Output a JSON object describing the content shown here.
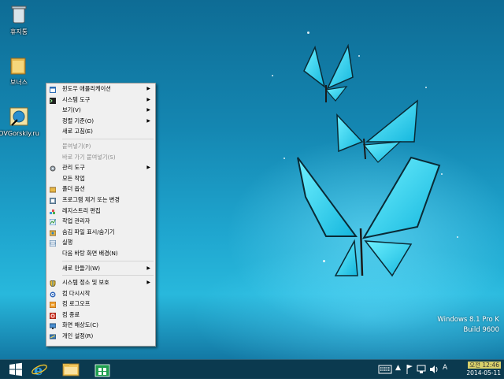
{
  "desktop": {
    "icons": [
      {
        "label": "휴지통",
        "icon": "recycle-bin-icon"
      },
      {
        "label": "보너스",
        "icon": "folder-icon"
      },
      {
        "label": "OVGorskiy.ru",
        "icon": "website-shortcut-icon"
      }
    ],
    "watermark": {
      "line1": "Windows 8.1 Pro K",
      "line2": "Build 9600"
    }
  },
  "context_menu": {
    "items": [
      {
        "label": "윈도우 애플리케이션",
        "icon": "app-window-icon",
        "submenu": true,
        "disabled": false
      },
      {
        "label": "시스템 도구",
        "icon": "terminal-icon",
        "submenu": true,
        "disabled": false
      },
      {
        "label": "보기(V)",
        "icon": "",
        "submenu": true,
        "disabled": false
      },
      {
        "label": "정렬 기준(O)",
        "icon": "",
        "submenu": true,
        "disabled": false
      },
      {
        "label": "새로 고침(E)",
        "icon": "",
        "submenu": false,
        "disabled": false
      },
      {
        "sep": true
      },
      {
        "label": "붙여넣기(P)",
        "icon": "",
        "submenu": false,
        "disabled": true
      },
      {
        "label": "바로 가기 붙여넣기(S)",
        "icon": "",
        "submenu": false,
        "disabled": true
      },
      {
        "label": "관리 도구",
        "icon": "admin-tools-icon",
        "submenu": true,
        "disabled": false
      },
      {
        "label": "모든 작업",
        "icon": "",
        "submenu": false,
        "disabled": false
      },
      {
        "label": "폴더 옵션",
        "icon": "folder-options-icon",
        "submenu": false,
        "disabled": false
      },
      {
        "label": "프로그램 제거 또는 변경",
        "icon": "programs-icon",
        "submenu": false,
        "disabled": false
      },
      {
        "label": "레지스트리 편집",
        "icon": "registry-icon",
        "submenu": false,
        "disabled": false
      },
      {
        "label": "작업 관리자",
        "icon": "task-manager-icon",
        "submenu": false,
        "disabled": false
      },
      {
        "label": "숨김 파일 표시/숨기기",
        "icon": "hidden-files-icon",
        "submenu": false,
        "disabled": false
      },
      {
        "label": "실행",
        "icon": "run-icon",
        "submenu": false,
        "disabled": false
      },
      {
        "label": "다음 바탕 화면 배경(N)",
        "icon": "",
        "submenu": false,
        "disabled": false
      },
      {
        "sep": true
      },
      {
        "label": "새로 만들기(W)",
        "icon": "",
        "submenu": true,
        "disabled": false
      },
      {
        "sep": true
      },
      {
        "label": "시스템 정소 및 보호",
        "icon": "shield-icon",
        "submenu": true,
        "disabled": false
      },
      {
        "label": "컴 다시시작",
        "icon": "restart-icon",
        "submenu": false,
        "disabled": false
      },
      {
        "label": "컴 로그오프",
        "icon": "logoff-icon",
        "submenu": false,
        "disabled": false
      },
      {
        "label": "컴 종료",
        "icon": "shutdown-icon",
        "submenu": false,
        "disabled": false
      },
      {
        "label": "화면 해상도(C)",
        "icon": "display-icon",
        "submenu": false,
        "disabled": false
      },
      {
        "label": "개인 설정(R)",
        "icon": "personalize-icon",
        "submenu": false,
        "disabled": false
      }
    ]
  },
  "taskbar": {
    "buttons": [
      "windows-logo-icon",
      "internet-explorer-icon",
      "file-explorer-icon",
      "store-icon"
    ],
    "tray": {
      "ime": "A",
      "time": "오전 12:46",
      "date": "2014-05-11"
    }
  },
  "colors": {
    "taskbar": "#0b3a4f",
    "menu_bg": "#f0f0f0",
    "accent": "#1fa6cf"
  }
}
